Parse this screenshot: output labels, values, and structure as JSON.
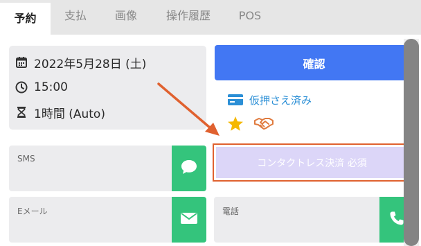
{
  "tabs": [
    {
      "label": "予約",
      "active": true
    },
    {
      "label": "支払",
      "active": false
    },
    {
      "label": "画像",
      "active": false
    },
    {
      "label": "操作履歴",
      "active": false
    },
    {
      "label": "POS",
      "active": false
    }
  ],
  "booking": {
    "date": "2022年5月28日 (土)",
    "time": "15:00",
    "duration": "1時間 (Auto)"
  },
  "actions": {
    "confirm_label": "確認",
    "provisional_label": "仮押さえ済み",
    "contactless_label": "コンタクトレス決済 必須"
  },
  "contact": {
    "sms_label": "SMS",
    "email_label": "Eメール",
    "phone_label": "電話"
  },
  "colors": {
    "confirm": "#4277f3",
    "green": "#34c47c",
    "link": "#2b8fd6",
    "highlight": "#e0612f",
    "contactless_bg": "#dcd6f8"
  },
  "icons": {
    "date": "calendar-icon",
    "time": "clock-icon",
    "duration": "hourglass-icon",
    "provisional": "credit-card-icon",
    "star": "star-icon",
    "handshake": "handshake-icon",
    "sms": "chat-bubble-icon",
    "email": "envelope-icon",
    "phone": "phone-icon"
  }
}
